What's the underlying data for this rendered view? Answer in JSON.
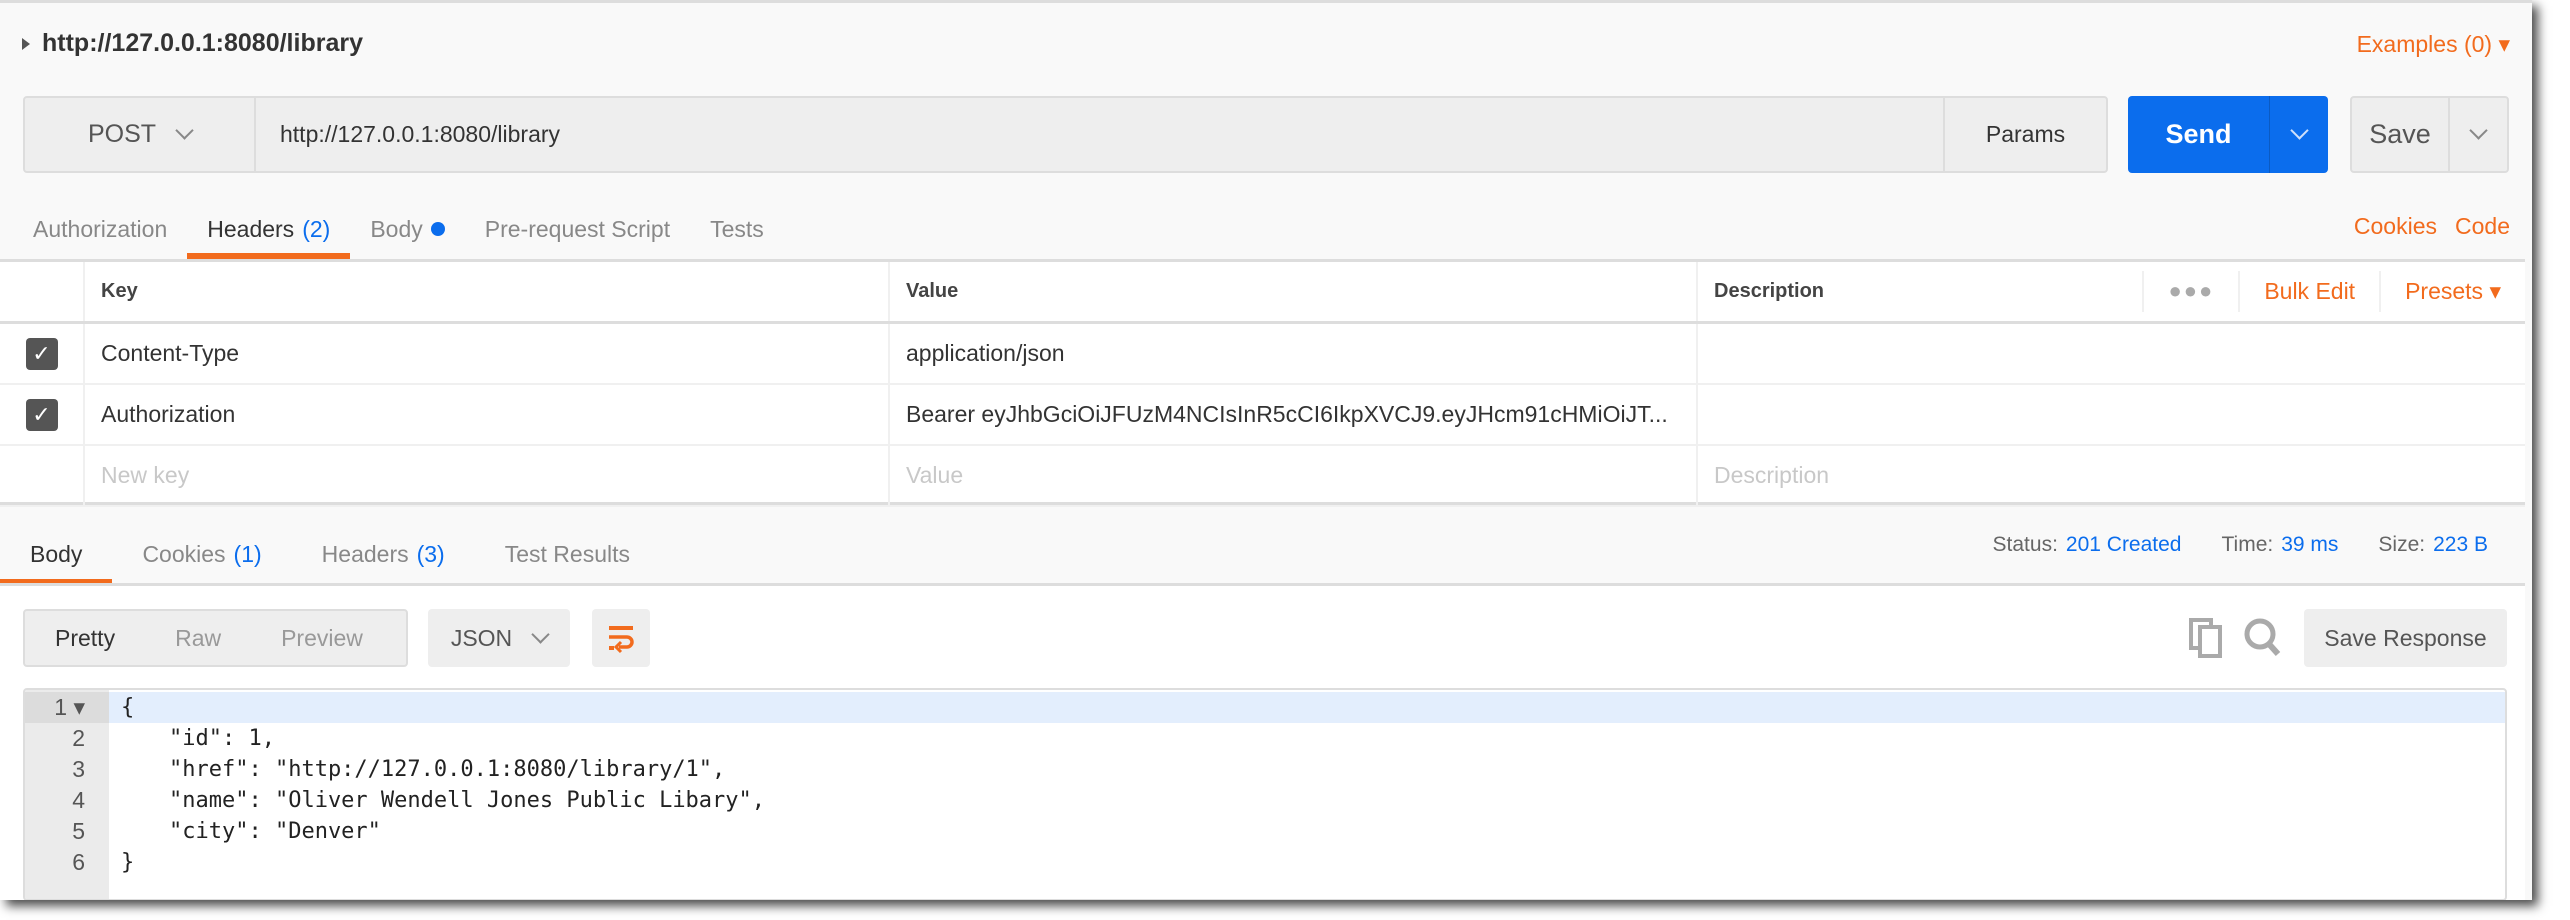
{
  "request": {
    "title": "http://127.0.0.1:8080/library",
    "examples_label": "Examples (0)",
    "method": "POST",
    "url": "http://127.0.0.1:8080/library",
    "params_label": "Params",
    "send_label": "Send",
    "save_label": "Save"
  },
  "request_tabs": [
    {
      "label": "Authorization"
    },
    {
      "label": "Headers",
      "count": "(2)",
      "active": true
    },
    {
      "label": "Body",
      "dot": true
    },
    {
      "label": "Pre-request Script"
    },
    {
      "label": "Tests"
    }
  ],
  "request_links": {
    "cookies": "Cookies",
    "code": "Code"
  },
  "headers_table": {
    "columns": {
      "key": "Key",
      "value": "Value",
      "description": "Description"
    },
    "bulk_edit": "Bulk Edit",
    "presets": "Presets",
    "rows": [
      {
        "checked": true,
        "key": "Content-Type",
        "value": "application/json",
        "description": ""
      },
      {
        "checked": true,
        "key": "Authorization",
        "value": "Bearer eyJhbGciOiJFUzM4NCIsInR5cCI6IkpXVCJ9.eyJHcm91cHMiOiJT...",
        "description": ""
      }
    ],
    "new_row": {
      "key_placeholder": "New key",
      "value_placeholder": "Value",
      "description_placeholder": "Description"
    }
  },
  "response_tabs": [
    {
      "label": "Body",
      "active": true
    },
    {
      "label": "Cookies",
      "count": "(1)"
    },
    {
      "label": "Headers",
      "count": "(3)"
    },
    {
      "label": "Test Results"
    }
  ],
  "response_status": {
    "status_label": "Status:",
    "status": "201 Created",
    "time_label": "Time:",
    "time": "39 ms",
    "size_label": "Size:",
    "size": "223 B"
  },
  "response_toolbar": {
    "views": [
      "Pretty",
      "Raw",
      "Preview"
    ],
    "active_view": "Pretty",
    "format": "JSON",
    "save_response": "Save Response"
  },
  "response_body": {
    "lines": [
      "{",
      "\"id\": 1,",
      "\"href\": \"http://127.0.0.1:8080/library/1\",",
      "\"name\": \"Oliver Wendell Jones Public Libary\",",
      "\"city\": \"Denver\"",
      "}"
    ]
  },
  "colors": {
    "accent": "#f26b1d",
    "primary": "#0b6ded"
  }
}
